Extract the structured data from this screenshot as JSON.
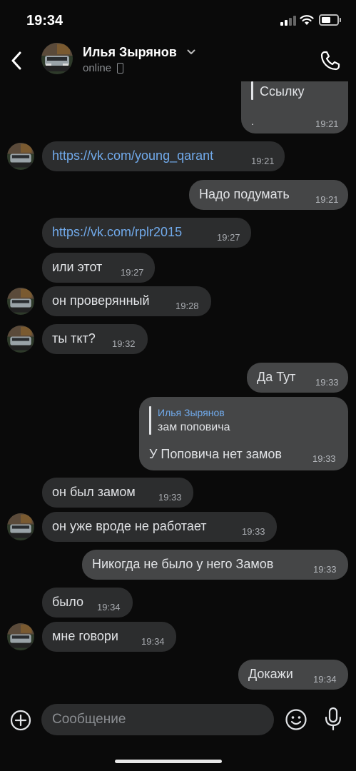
{
  "status_bar": {
    "time": "19:34"
  },
  "header": {
    "contact_name": "Илья Зырянов",
    "status": "online"
  },
  "messages": [
    {
      "dir": "out",
      "quote": "Ссылку",
      "extra": ".",
      "time": "19:21"
    },
    {
      "dir": "in",
      "text": "https://vk.com/young_qarant",
      "link": true,
      "time": "19:21",
      "avatar": true
    },
    {
      "dir": "out",
      "text": "Надо подумать",
      "time": "19:21"
    },
    {
      "dir": "in",
      "text": "https://vk.com/rplr2015",
      "link": true,
      "time": "19:27",
      "avatar": false
    },
    {
      "dir": "in",
      "text": "или этот",
      "time": "19:27",
      "avatar": false
    },
    {
      "dir": "in",
      "text": "он проверянный",
      "time": "19:28",
      "avatar": true
    },
    {
      "dir": "in",
      "text": "ты ткт?",
      "time": "19:32",
      "avatar": true
    },
    {
      "dir": "out",
      "text": "Да Тут",
      "time": "19:33"
    },
    {
      "dir": "out",
      "reply_name": "Илья Зырянов",
      "reply_text": "зам поповича",
      "text": "У Поповича нет замов",
      "time": "19:33"
    },
    {
      "dir": "in",
      "text": "он был замом",
      "time": "19:33",
      "avatar": false
    },
    {
      "dir": "in",
      "text": "он уже вроде не работает",
      "time": "19:33",
      "avatar": true
    },
    {
      "dir": "out",
      "text": "Никогда не было у него Замов",
      "time": "19:33"
    },
    {
      "dir": "in",
      "text": "было",
      "time": "19:34",
      "avatar": false
    },
    {
      "dir": "in",
      "text": "мне говори",
      "time": "19:34",
      "avatar": true
    },
    {
      "dir": "out",
      "text": "Докажи",
      "time": "19:34"
    }
  ],
  "composer": {
    "placeholder": "Сообщение"
  },
  "icons": {
    "back": "chevron-left-icon",
    "call": "phone-icon",
    "attach": "plus-circle-icon",
    "emoji": "smile-icon",
    "mic": "microphone-icon"
  },
  "colors": {
    "background": "#0a0a0a",
    "incoming_bubble": "#2c2d2e",
    "outgoing_bubble": "#454647",
    "link": "#71aaeb",
    "timestamp": "#a8abb0"
  }
}
